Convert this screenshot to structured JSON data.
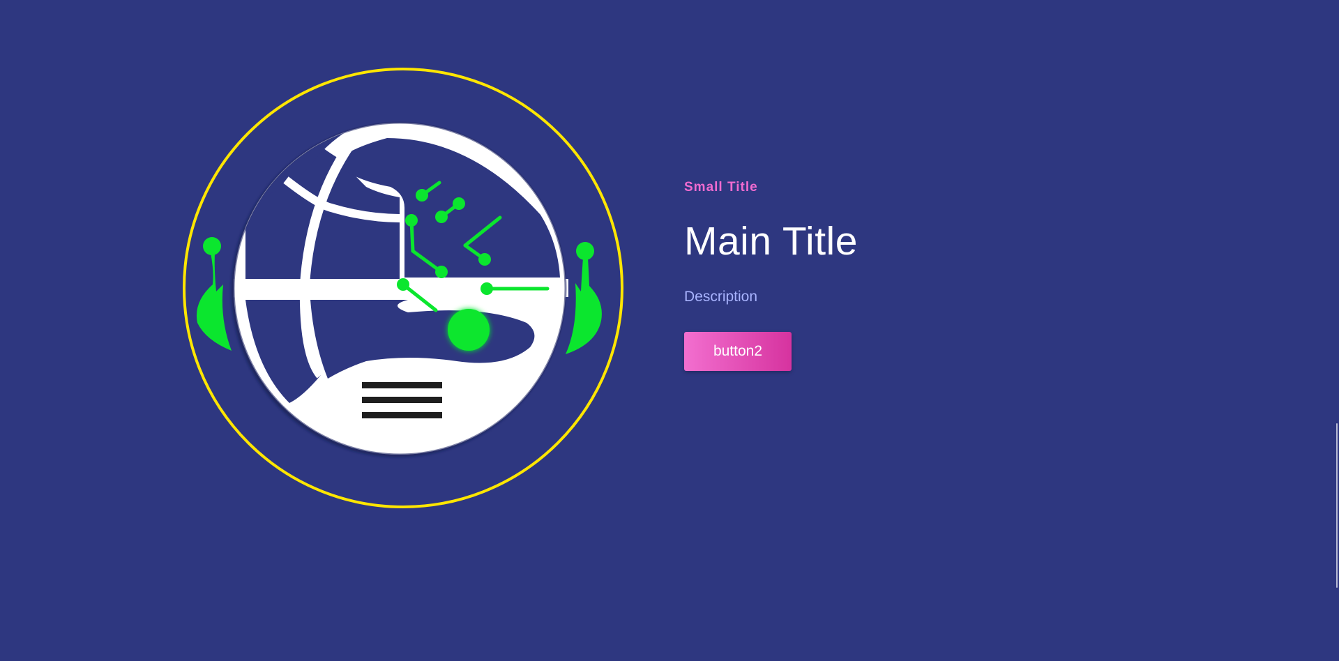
{
  "hero": {
    "small_title": "Small Title",
    "main_title": "Main Title",
    "description": "Description",
    "button_label": "button2"
  },
  "emblem": {
    "icon": "globe-network-icon",
    "colors": {
      "ring": "#ffe600",
      "globe": "#ffffff",
      "accent": "#0be62e",
      "lines": "#1e1e1e"
    }
  },
  "theme": {
    "background": "#2e3780",
    "accent": "#f06bd0",
    "description_color": "#a9b4ff"
  }
}
